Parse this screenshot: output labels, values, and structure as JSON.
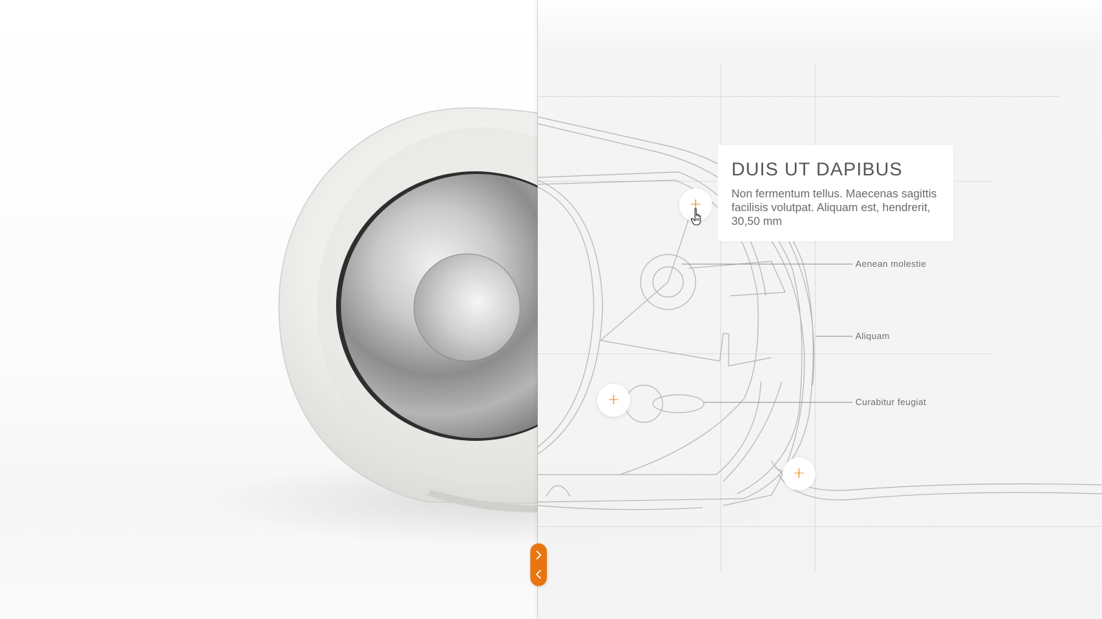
{
  "info_card": {
    "title": "DUIS UT DAPIBUS",
    "body": "Non fermentum tellus. Maecenas sagittis facilisis volutpat. Aliquam est, hendrerit, 30,50 mm"
  },
  "callouts": [
    {
      "label": "Aenean molestie"
    },
    {
      "label": "Aliquam"
    },
    {
      "label": "Curabitur feugiat"
    }
  ],
  "hotspots": [
    {
      "icon": "plus-icon",
      "symbol": "+"
    },
    {
      "icon": "plus-icon",
      "symbol": "+"
    },
    {
      "icon": "plus-icon",
      "symbol": "+"
    }
  ],
  "slider": {
    "icon_next": "chevron-right-icon",
    "icon_prev": "chevron-left-icon"
  },
  "colors": {
    "accent": "#e8750f",
    "blueprint_bg": "#f3f3f3",
    "blueprint_line": "#b9b9b9",
    "text": "#6a6a6a"
  }
}
